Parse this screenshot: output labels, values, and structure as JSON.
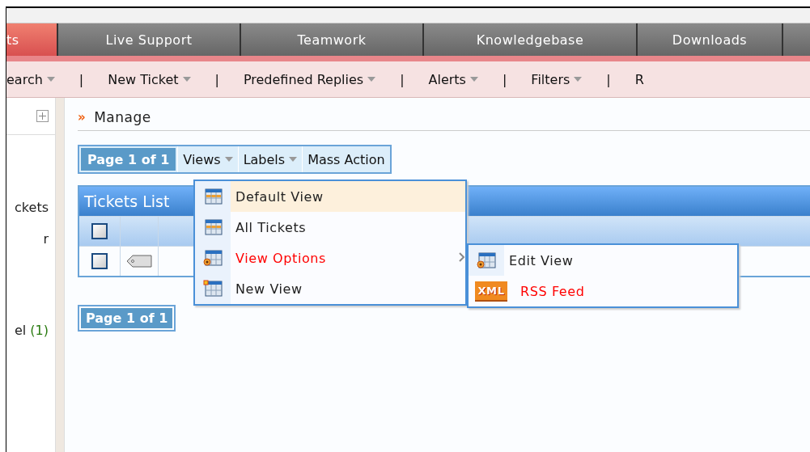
{
  "tabs": [
    {
      "label": "ts",
      "selected": true
    },
    {
      "label": "Live Support",
      "selected": false
    },
    {
      "label": "Teamwork",
      "selected": false
    },
    {
      "label": "Knowledgebase",
      "selected": false
    },
    {
      "label": "Downloads",
      "selected": false
    },
    {
      "selected": false
    }
  ],
  "nav": [
    {
      "label": "earch",
      "dropdown": true
    },
    {
      "label": "New Ticket",
      "dropdown": true
    },
    {
      "label": "Predefined Replies",
      "dropdown": true
    },
    {
      "label": "Alerts",
      "dropdown": true
    },
    {
      "label": "Filters",
      "dropdown": true
    },
    {
      "label": "R",
      "dropdown": false
    }
  ],
  "nav_separator": "|",
  "sidebar": {
    "items": [
      {
        "label": "ckets"
      },
      {
        "label": "r"
      },
      {
        "label": "el",
        "count": "(1)"
      }
    ]
  },
  "breadcrumb": {
    "marker": "»",
    "title": "Manage"
  },
  "toolbar": {
    "pager": "Page 1 of 1",
    "buttons": [
      {
        "label": "Views",
        "dropdown": true
      },
      {
        "label": "Labels",
        "dropdown": true
      },
      {
        "label": "Mass Action",
        "dropdown": false
      }
    ]
  },
  "tickets_list": {
    "title": "Tickets List",
    "header_checkbox": {
      "checked": false
    },
    "rows": [
      {
        "checked": false
      }
    ]
  },
  "bottom_pager": "Page 1 of 1",
  "views_menu": {
    "items": [
      {
        "label": "Default View",
        "kind": "view",
        "selected": true,
        "emphasized": false,
        "submenu": false
      },
      {
        "label": "All Tickets",
        "kind": "view",
        "selected": false,
        "emphasized": false,
        "submenu": false
      },
      {
        "label": "View Options",
        "kind": "options",
        "selected": false,
        "emphasized": true,
        "submenu": true
      },
      {
        "label": "New View",
        "kind": "new",
        "selected": false,
        "emphasized": false,
        "submenu": false
      }
    ]
  },
  "view_options_menu": {
    "items": [
      {
        "label": "Edit View",
        "kind": "options",
        "selected": false,
        "emphasized": false
      },
      {
        "label": "RSS Feed",
        "kind": "feed",
        "badge": "XML",
        "selected": false,
        "emphasized": true
      }
    ]
  }
}
